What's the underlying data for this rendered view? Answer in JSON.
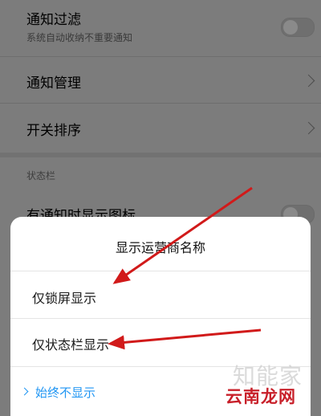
{
  "settings": {
    "notification_filter": {
      "title": "通知过滤",
      "subtitle": "系统自动收纳不重要通知"
    },
    "notification_management": {
      "title": "通知管理"
    },
    "toggle_sort": {
      "title": "开关排序"
    },
    "status_bar_section": "状态栏",
    "show_icon_on_notification": {
      "title": "有通知时显示图标"
    }
  },
  "sheet": {
    "title": "显示运营商名称",
    "options": [
      {
        "label": "仅锁屏显示",
        "selected": false
      },
      {
        "label": "仅状态栏显示",
        "selected": false
      },
      {
        "label": "始终不显示",
        "selected": true
      }
    ]
  },
  "watermark": {
    "line1": "知能家",
    "line2": "云南龙网"
  },
  "colors": {
    "accent": "#2196f3",
    "annotation_arrow": "#d11a1a",
    "overlay": "#7c7c7c"
  }
}
